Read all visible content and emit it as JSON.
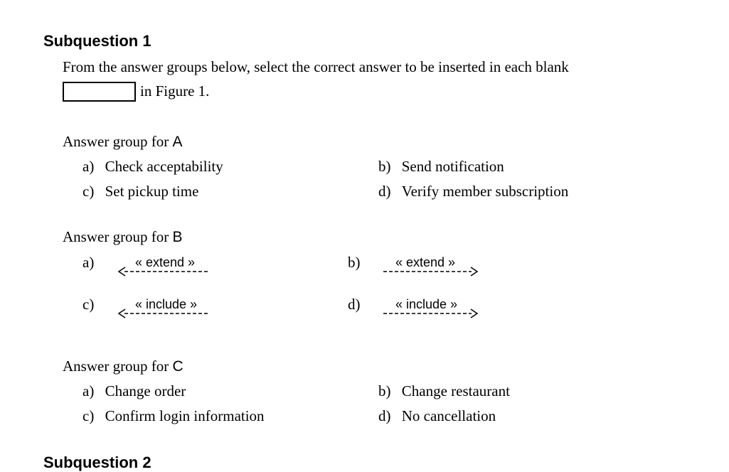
{
  "subquestion1": {
    "heading": "Subquestion 1",
    "instruction_line1": "From the answer groups below, select the correct answer to be inserted in each blank",
    "instruction_line2": "in Figure 1."
  },
  "group_a": {
    "title_prefix": "Answer group for",
    "title_letter": "A",
    "options": [
      {
        "letter": "a)",
        "text": "Check acceptability"
      },
      {
        "letter": "b)",
        "text": "Send notification"
      },
      {
        "letter": "c)",
        "text": "Set pickup time"
      },
      {
        "letter": "d)",
        "text": "Verify member subscription"
      }
    ]
  },
  "group_b": {
    "title_prefix": "Answer group for",
    "title_letter": "B",
    "options": [
      {
        "letter": "a)",
        "label": "« extend »",
        "direction": "left"
      },
      {
        "letter": "b)",
        "label": "« extend »",
        "direction": "right"
      },
      {
        "letter": "c)",
        "label": "« include »",
        "direction": "left"
      },
      {
        "letter": "d)",
        "label": "« include »",
        "direction": "right"
      }
    ]
  },
  "group_c": {
    "title_prefix": "Answer group for",
    "title_letter": "C",
    "options": [
      {
        "letter": "a)",
        "text": "Change order"
      },
      {
        "letter": "b)",
        "text": "Change restaurant"
      },
      {
        "letter": "c)",
        "text": "Confirm login information"
      },
      {
        "letter": "d)",
        "text": "No cancellation"
      }
    ]
  },
  "subquestion2": {
    "heading": "Subquestion 2"
  }
}
